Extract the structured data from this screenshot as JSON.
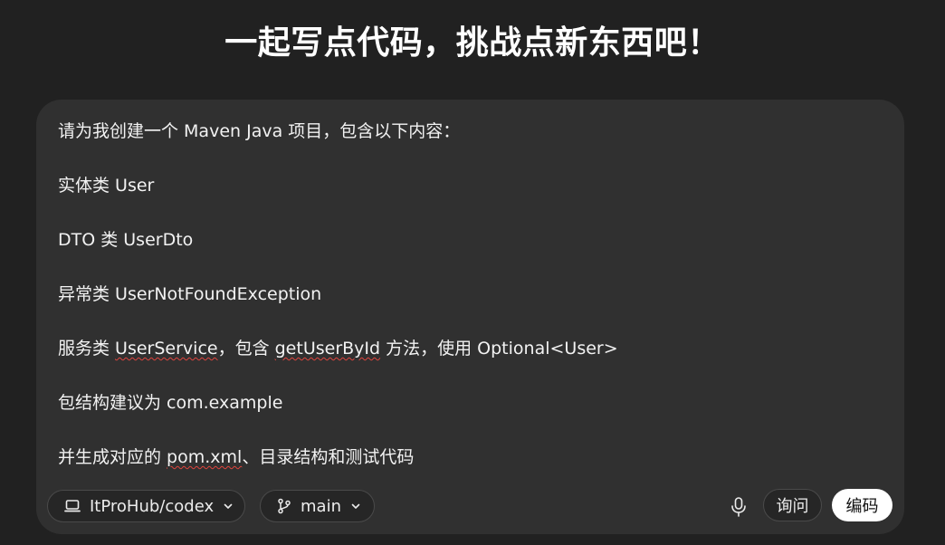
{
  "headline": "一起写点代码，挑战点新东西吧！",
  "prompt": {
    "lines": [
      "请为我创建一个 Maven Java 项目，包含以下内容：",
      "实体类 User",
      "DTO 类 UserDto",
      "异常类 UserNotFoundException",
      "服务类 UserService，包含 getUserById 方法，使用 Optional<User>",
      "包结构建议为 com.example",
      "并生成对应的 pom.xml、目录结构和测试代码"
    ],
    "line5_parts": [
      "服务类 ",
      "UserService",
      "，包含 ",
      "getUserById",
      " 方法，使用 Optional<User>"
    ],
    "line7_parts": [
      "并生成对应的 ",
      "pom.xml",
      "、目录结构和测试代码"
    ]
  },
  "toolbar": {
    "repo_label": "ItProHub/codex",
    "repo_icon": "laptop-icon",
    "branch_label": "main",
    "branch_icon": "git-branch-icon",
    "mic_icon": "microphone-icon",
    "ask_label": "询问",
    "code_label": "编码"
  },
  "colors": {
    "background": "#212121",
    "composer": "#303030",
    "primary_button": "#ffffff",
    "spellcheck_underline": "#e0443e"
  }
}
